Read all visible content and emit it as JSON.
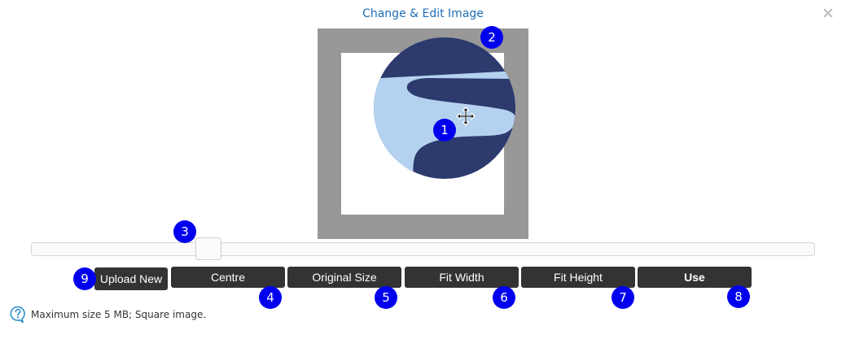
{
  "dialog": {
    "title": "Change & Edit Image",
    "close_symbol": "✕"
  },
  "image_editor": {
    "image_alt": "circular logo with light blue wave",
    "move_icon": "move-arrows-icon"
  },
  "zoom_slider": {
    "level": 0.23
  },
  "buttons": {
    "upload_new": "Upload New",
    "centre": "Centre",
    "original_size": "Original Size",
    "fit_width": "Fit Width",
    "fit_height": "Fit Height",
    "use": "Use"
  },
  "hint": {
    "icon": "help-circle-icon",
    "text": "Maximum size 5 MB; Square image."
  },
  "markers": [
    "1",
    "2",
    "3",
    "4",
    "5",
    "6",
    "7",
    "8",
    "9"
  ],
  "colors": {
    "accent": "#1f6fb5",
    "logo_dark": "#2d3a6e",
    "logo_light": "#b4d2ef",
    "button_bg": "#333333",
    "marker": "#0000ee",
    "crop_bg": "#989898"
  }
}
